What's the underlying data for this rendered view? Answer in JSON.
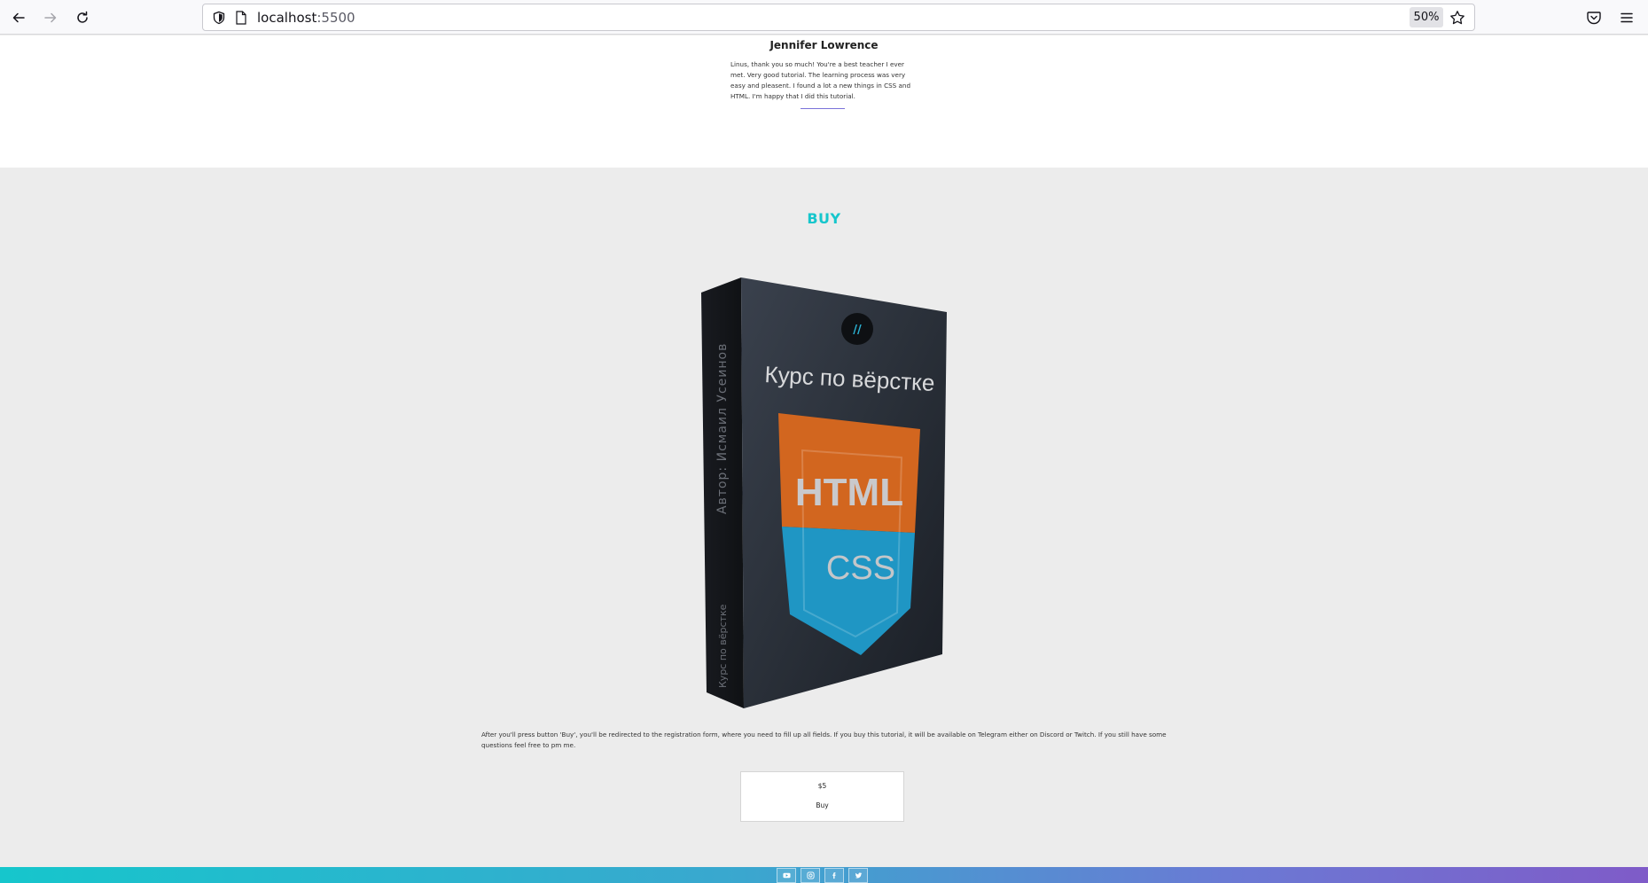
{
  "browser": {
    "url_host": "localhost",
    "url_port": ":5500",
    "zoom": "50%"
  },
  "testimonial": {
    "name": "Jennifer Lowrence",
    "text": "Linus, thank you so much! You're a best teacher I ever met. Very good tutorial. The learning process was very easy and pleasent. I found a lot a new things in CSS and HTML. I'm happy that I did this tutorial."
  },
  "buy": {
    "title": "BUY",
    "box": {
      "title": "Курс по вёрстке",
      "spine_author": "Автор: Исмаил Усеинов",
      "spine_course": "Курс по вёрстке",
      "badge_top": "HTML",
      "badge_bottom": "CSS",
      "logo_mark": "//"
    },
    "description": "After you'll press button 'Buy', you'll be redirected to the registration form, where you need to fill up all fields. If you buy this tutorial, it will be available on Telegram either on Discord or Twitch. If you still have some questions feel free to pm me.",
    "price": "$5",
    "button_label": "Buy"
  },
  "footer": {
    "icons": [
      "youtube-icon",
      "instagram-icon",
      "facebook-icon",
      "twitter-icon"
    ]
  },
  "colors": {
    "accent": "#16c6cc",
    "gradient_end": "#7f5bc8",
    "box_orange": "#d2661f",
    "box_blue": "#1f96c4"
  }
}
